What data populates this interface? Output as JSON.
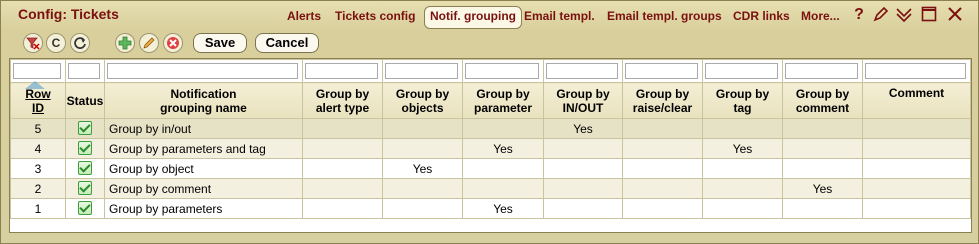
{
  "window": {
    "title": "Config: Tickets"
  },
  "tabs": [
    {
      "label": "Alerts",
      "active": false
    },
    {
      "label": "Tickets config",
      "active": false
    },
    {
      "label": "Notif. grouping",
      "active": true
    },
    {
      "label": "Email templ.",
      "active": false
    },
    {
      "label": "Email templ. groups",
      "active": false
    },
    {
      "label": "CDR links",
      "active": false
    },
    {
      "label": "More...",
      "active": false
    }
  ],
  "window_icons": [
    "help-icon",
    "edit-icon",
    "collapse-icon",
    "maximize-icon",
    "close-icon"
  ],
  "toolbar": {
    "icons": [
      "clear-filter-icon",
      "reset-icon",
      "refresh-icon",
      "add-icon",
      "edit-icon",
      "delete-icon"
    ],
    "save_label": "Save",
    "cancel_label": "Cancel"
  },
  "table": {
    "columns": [
      [
        "Row",
        "ID"
      ],
      [
        "Status",
        ""
      ],
      [
        "Notification",
        "grouping name"
      ],
      [
        "Group by",
        "alert type"
      ],
      [
        "Group by",
        "objects"
      ],
      [
        "Group by",
        "parameter"
      ],
      [
        "Group by",
        "IN/OUT"
      ],
      [
        "Group by",
        "raise/clear"
      ],
      [
        "Group by",
        "tag"
      ],
      [
        "Group by",
        "comment"
      ],
      [
        "Comment",
        ""
      ]
    ],
    "rows": [
      {
        "id": "5",
        "name": "Group by in/out",
        "alert_type": "",
        "objects": "",
        "parameter": "",
        "inout": "Yes",
        "raise": "",
        "tag": "",
        "gcomment": "",
        "comment": ""
      },
      {
        "id": "4",
        "name": "Group by parameters and tag",
        "alert_type": "",
        "objects": "",
        "parameter": "Yes",
        "inout": "",
        "raise": "",
        "tag": "Yes",
        "gcomment": "",
        "comment": ""
      },
      {
        "id": "3",
        "name": "Group by object",
        "alert_type": "",
        "objects": "Yes",
        "parameter": "",
        "inout": "",
        "raise": "",
        "tag": "",
        "gcomment": "",
        "comment": ""
      },
      {
        "id": "2",
        "name": "Group by comment",
        "alert_type": "",
        "objects": "",
        "parameter": "",
        "inout": "",
        "raise": "",
        "tag": "",
        "gcomment": "Yes",
        "comment": ""
      },
      {
        "id": "1",
        "name": "Group by parameters",
        "alert_type": "",
        "objects": "",
        "parameter": "Yes",
        "inout": "",
        "raise": "",
        "tag": "",
        "gcomment": "",
        "comment": ""
      }
    ]
  },
  "colors": {
    "accent": "#7a1010",
    "background": "#d6cfa0",
    "row_selected": "#e6e2c6"
  }
}
